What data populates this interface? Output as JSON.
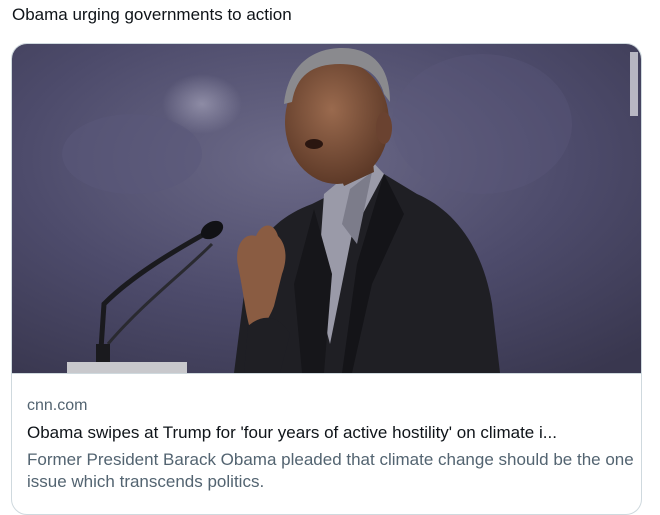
{
  "tweet": {
    "text": "Obama urging governments to action"
  },
  "card": {
    "domain": "cnn.com",
    "title": "Obama swipes at Trump for 'four years of active hostility' on climate i...",
    "description": "Former President Barack Obama pleaded that climate change should be the one issue which transcends politics."
  },
  "colors": {
    "text_primary": "#0f1419",
    "text_secondary": "#536471",
    "card_border": "#cfd9de",
    "photo_background": "#4a4868"
  }
}
